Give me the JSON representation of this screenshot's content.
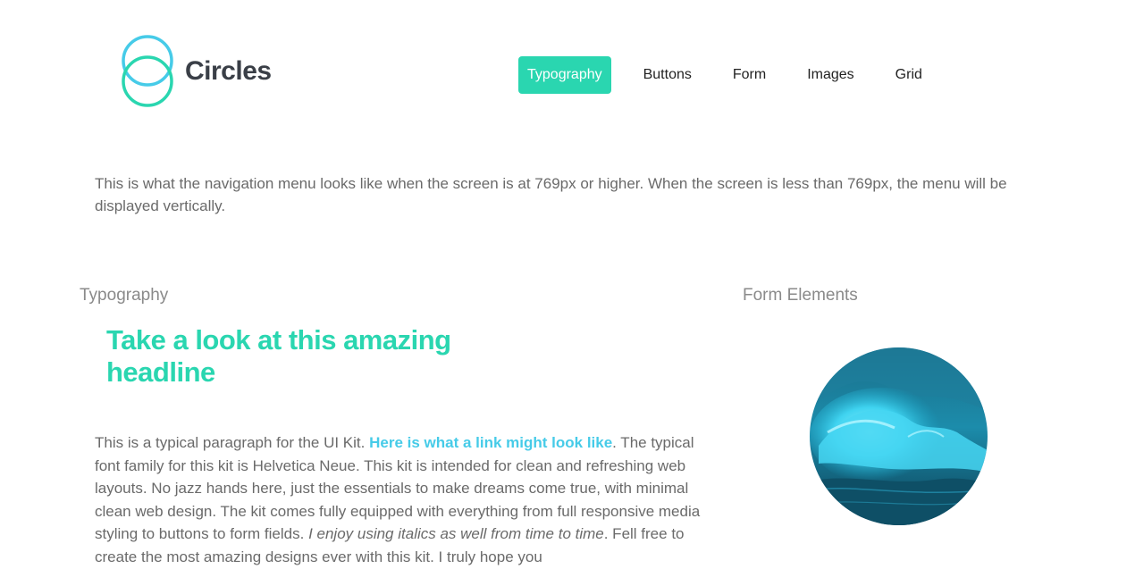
{
  "brand": {
    "name": "Circles"
  },
  "nav": {
    "items": [
      {
        "label": "Typography",
        "active": true
      },
      {
        "label": "Buttons",
        "active": false
      },
      {
        "label": "Form",
        "active": false
      },
      {
        "label": "Images",
        "active": false
      },
      {
        "label": "Grid",
        "active": false
      }
    ]
  },
  "intro": {
    "text": "This is what the navigation menu looks like when the screen is at 769px or higher. When the screen is less than 769px, the menu will be displayed vertically."
  },
  "typography": {
    "heading": "Typography",
    "headline": "Take a look at this amazing headline",
    "paragraph": {
      "before_link": "This is a typical paragraph for the UI Kit. ",
      "link": "Here is what a link might look like",
      "after_link": ". The typical font family for this kit is Helvetica Neue. This kit is intended for clean and refreshing web layouts. No jazz hands here, just the essentials to make dreams come true, with minimal clean web design. The kit comes fully equipped with everything from full responsive media styling to buttons to form fields. ",
      "italic": "I enjoy using italics as well from time to time",
      "after_italic": ". Fell free to create the most amazing designs ever with this kit. I truly hope you"
    }
  },
  "form_elements": {
    "heading": "Form Elements",
    "image_icon": "ocean-wave-image"
  },
  "colors": {
    "accent": "#2ad6b0",
    "link": "#46cbe8",
    "logo_ring_top": "#46cbe8",
    "logo_ring_bottom": "#2ad6b0",
    "text": "#6a6a6a"
  }
}
